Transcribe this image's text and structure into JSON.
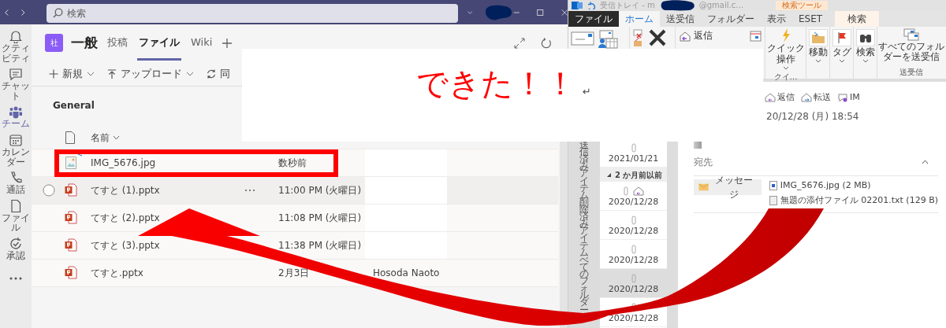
{
  "teams": {
    "search": {
      "placeholder": "検索"
    },
    "rail": [
      {
        "label": "クティビティ",
        "kind": "bell",
        "selected": false
      },
      {
        "label": "チャット",
        "kind": "chat",
        "selected": false
      },
      {
        "label": "チーム",
        "kind": "teams",
        "selected": true
      },
      {
        "label": "カレンダー",
        "kind": "calendar",
        "selected": false
      },
      {
        "label": "通話",
        "kind": "phone",
        "selected": false
      },
      {
        "label": "ファイル",
        "kind": "file",
        "selected": false
      },
      {
        "label": "承認",
        "kind": "approval",
        "selected": false
      }
    ],
    "channel": {
      "avatar": "社",
      "name": "一般",
      "tabs": [
        {
          "label": "投稿",
          "selected": false
        },
        {
          "label": "ファイル",
          "selected": true
        },
        {
          "label": "Wiki",
          "selected": false
        }
      ]
    },
    "toolbar": [
      {
        "label": "新規",
        "kind": "new"
      },
      {
        "label": "アップロード",
        "kind": "upload"
      },
      {
        "label": "同",
        "kind": "sync"
      }
    ],
    "folder_title": "General",
    "name_column": "名前",
    "files": [
      {
        "kind": "image",
        "name": "IMG_5676.jpg",
        "modified": "数秒前",
        "hovered": false,
        "new": true,
        "redacted": true
      },
      {
        "kind": "pptx",
        "name": "てすと (1).pptx",
        "modified": "11:00 PM (火曜日)",
        "hovered": true,
        "new": false,
        "redacted": true
      },
      {
        "kind": "pptx",
        "name": "てすと (2).pptx",
        "modified": "11:08 PM (火曜日)",
        "hovered": false,
        "new": false,
        "redacted": true
      },
      {
        "kind": "pptx",
        "name": "てすと (3).pptx",
        "modified": "11:38 PM (火曜日)",
        "hovered": false,
        "new": false,
        "redacted": true
      },
      {
        "kind": "pptx",
        "name": "てすと.pptx",
        "modified": "2月3日",
        "modified_by": "Hosoda Naoto",
        "hovered": false,
        "new": false,
        "redacted": false
      }
    ]
  },
  "outlook": {
    "title_parts": [
      "受信トレイ - m",
      "@gmail.c…"
    ],
    "context_tab": "検索ツール",
    "tabs": [
      {
        "label": "ファイル",
        "kind": "file",
        "selected": false
      },
      {
        "label": "ホーム",
        "kind": "tab",
        "selected": true
      },
      {
        "label": "送受信",
        "kind": "tab",
        "selected": false
      },
      {
        "label": "フォルダー",
        "kind": "tab",
        "selected": false
      },
      {
        "label": "表示",
        "kind": "tab",
        "selected": false
      },
      {
        "label": "ESET",
        "kind": "tab",
        "selected": false
      },
      {
        "label": "検索",
        "kind": "context",
        "selected": false
      }
    ],
    "ribbon": {
      "reply": "返信",
      "quick_steps": "クイック操作",
      "quick_group": "クイ…",
      "move": "移動",
      "tags": "タグ",
      "find": "検索",
      "send_all": "すべてのフォルダーを送受信",
      "send_group": "送受信"
    },
    "folders": [
      "送信済みアイテム",
      "削除済みアイテム",
      "べてのフォルダー"
    ],
    "messages": [
      {
        "kind": "item",
        "date": "2021/01/21",
        "selected": false,
        "replied": false
      },
      {
        "kind": "group",
        "label": "2 か月前以前"
      },
      {
        "kind": "item",
        "date": "2020/12/28",
        "selected": false,
        "replied": true
      },
      {
        "kind": "item",
        "date": "2020/12/28",
        "selected": false,
        "replied": false
      },
      {
        "kind": "item",
        "date": "2020/12/28",
        "selected": false,
        "replied": false
      },
      {
        "kind": "item",
        "date": "2020/12/28",
        "selected": true,
        "replied": false
      },
      {
        "kind": "item",
        "date": "2020/12/28",
        "selected": false,
        "replied": false
      }
    ],
    "reading": {
      "actions": [
        {
          "label": "返信",
          "kind": "reply"
        },
        {
          "label": "転送",
          "kind": "forward"
        },
        {
          "label": "IM",
          "kind": "im"
        }
      ],
      "date": "20/12/28 (月) 18:54",
      "to_label": "宛先",
      "message_tab": "メッセージ",
      "attachments": [
        {
          "name": "IMG_5676.jpg (2 MB)",
          "kind": "image"
        },
        {
          "name": "無題の添付ファイル 02201.txt (129 B)",
          "kind": "text"
        }
      ]
    }
  },
  "annotation": {
    "text": "できた！！",
    "return_mark": "↵"
  }
}
